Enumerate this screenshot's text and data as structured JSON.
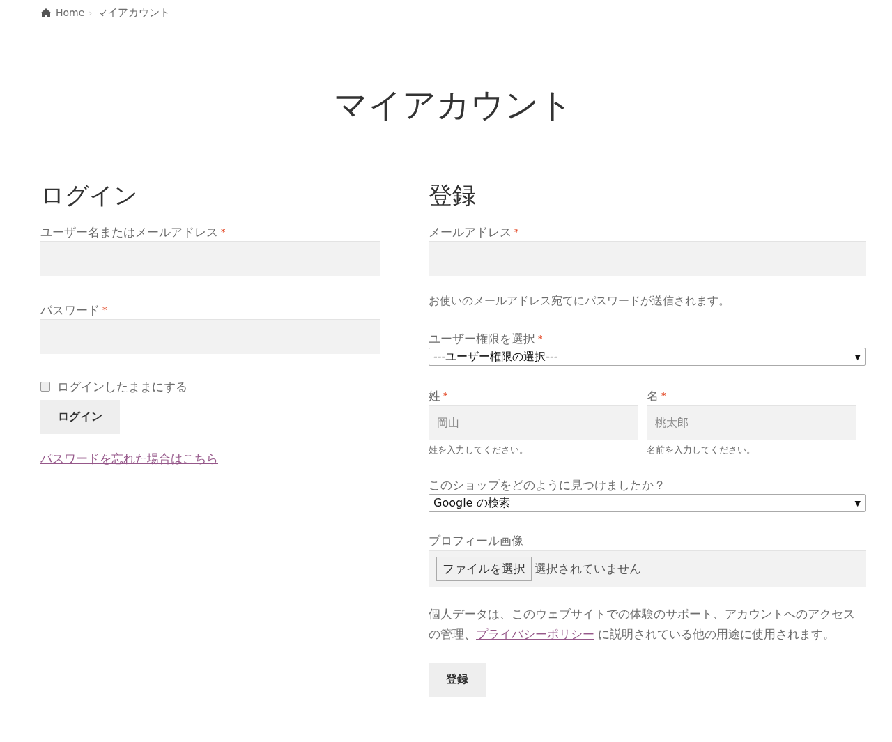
{
  "breadcrumb": {
    "home": "Home",
    "separator": "›",
    "current": "マイアカウント"
  },
  "page_title": "マイアカウント",
  "login": {
    "heading": "ログイン",
    "fields": [
      {
        "label": "ユーザー名またはメールアドレス",
        "required": "*"
      },
      {
        "label": "パスワード",
        "required": "*"
      }
    ],
    "remember": {
      "label": "ログインしたままにする",
      "checked": false
    },
    "button": "ログイン",
    "lost_password_link": "パスワードを忘れた場合はこちら"
  },
  "register": {
    "heading": "登録",
    "email": {
      "label": "メールアドレス",
      "required": "*"
    },
    "email_note": "お使いのメールアドレス宛てにパスワードが送信されます。",
    "role": {
      "label": "ユーザー権限を選択",
      "required": "*",
      "value": "---ユーザー権限の選択---",
      "caret": "▼"
    },
    "names": [
      {
        "label": "姓",
        "required": "*",
        "placeholder": "岡山",
        "hint": "姓を入力してください。"
      },
      {
        "label": "名",
        "required": "*",
        "placeholder": "桃太郎",
        "hint": "名前を入力してください。"
      }
    ],
    "referral": {
      "label": "このショップをどのように見つけましたか？",
      "value": "Google の検索",
      "caret": "▼"
    },
    "profile_image": {
      "label": "プロフィール画像",
      "button": "ファイルを選択",
      "status": "選択されていません"
    },
    "privacy": {
      "before": "個人データは、このウェブサイトでの体験のサポート、アカウントへのアクセスの管理、",
      "link": "プライバシーポリシー",
      "after": " に説明されている他の用途に使用されます。"
    },
    "button": "登録"
  }
}
